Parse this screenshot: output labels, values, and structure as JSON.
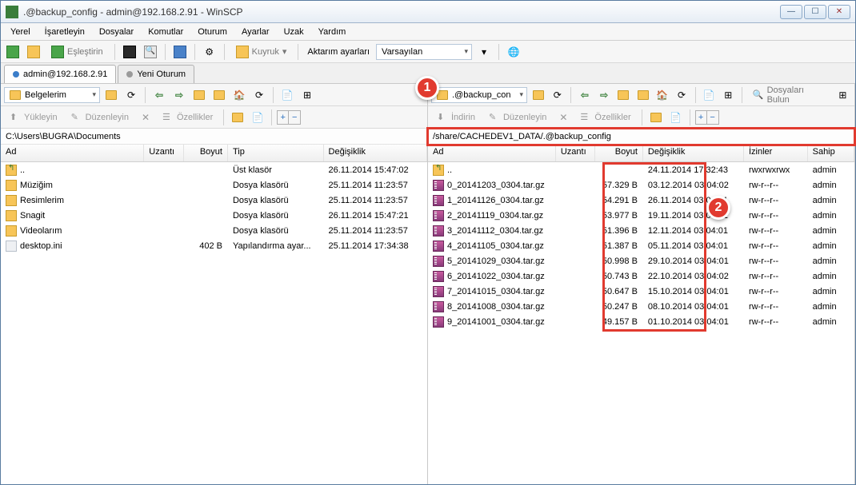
{
  "window": {
    "title": ".@backup_config - admin@192.168.2.91 - WinSCP"
  },
  "menu": {
    "m0": "Yerel",
    "m1": "İşaretleyin",
    "m2": "Dosyalar",
    "m3": "Komutlar",
    "m4": "Oturum",
    "m5": "Ayarlar",
    "m6": "Uzak",
    "m7": "Yardım"
  },
  "toolbar": {
    "sync": "Eşleştirin",
    "queue": "Kuyruk",
    "transfer_label": "Aktarım ayarları",
    "transfer_preset": "Varsayılan"
  },
  "tabs": {
    "t0": "admin@192.168.2.91",
    "t1": "Yeni Oturum"
  },
  "left": {
    "drive": "Belgelerim",
    "upload": "Yükleyin",
    "edit": "Düzenleyin",
    "props": "Özellikler",
    "path": "C:\\Users\\BUGRA\\Documents",
    "hdr": {
      "name": "Ad",
      "ext": "Uzantı",
      "size": "Boyut",
      "type": "Tip",
      "date": "Değişiklik"
    },
    "rows": [
      {
        "name": "..",
        "type": "Üst klasör",
        "date": "26.11.2014 15:47:02",
        "ico": "up"
      },
      {
        "name": "Müziğim",
        "type": "Dosya klasörü",
        "date": "25.11.2014 11:23:57",
        "ico": "folder"
      },
      {
        "name": "Resimlerim",
        "type": "Dosya klasörü",
        "date": "25.11.2014 11:23:57",
        "ico": "folder"
      },
      {
        "name": "Snagit",
        "type": "Dosya klasörü",
        "date": "26.11.2014 15:47:21",
        "ico": "folder"
      },
      {
        "name": "Videolarım",
        "type": "Dosya klasörü",
        "date": "25.11.2014 11:23:57",
        "ico": "folder"
      },
      {
        "name": "desktop.ini",
        "size": "402 B",
        "type": "Yapılandırma ayar...",
        "date": "25.11.2014 17:34:38",
        "ico": "file"
      }
    ]
  },
  "right": {
    "drive": ".@backup_con",
    "download": "İndirin",
    "edit": "Düzenleyin",
    "props": "Özellikler",
    "find": "Dosyaları Bulun",
    "path": "/share/CACHEDEV1_DATA/.@backup_config",
    "hdr": {
      "name": "Ad",
      "ext": "Uzantı",
      "size": "Boyut",
      "date": "Değişiklik",
      "perm": "İzinler",
      "own": "Sahip"
    },
    "rows": [
      {
        "name": "..",
        "date": "24.11.2014 17:32:43",
        "perm": "rwxrwxrwx",
        "own": "admin",
        "ico": "up"
      },
      {
        "name": "0_20141203_0304.tar.gz",
        "size": "57.329 B",
        "date": "03.12.2014 03:04:02",
        "perm": "rw-r--r--",
        "own": "admin",
        "ico": "archive"
      },
      {
        "name": "1_20141126_0304.tar.gz",
        "size": "54.291 B",
        "date": "26.11.2014 03:04:01",
        "perm": "rw-r--r--",
        "own": "admin",
        "ico": "archive"
      },
      {
        "name": "2_20141119_0304.tar.gz",
        "size": "53.977 B",
        "date": "19.11.2014 03:04:01",
        "perm": "rw-r--r--",
        "own": "admin",
        "ico": "archive"
      },
      {
        "name": "3_20141112_0304.tar.gz",
        "size": "51.396 B",
        "date": "12.11.2014 03:04:01",
        "perm": "rw-r--r--",
        "own": "admin",
        "ico": "archive"
      },
      {
        "name": "4_20141105_0304.tar.gz",
        "size": "51.387 B",
        "date": "05.11.2014 03:04:01",
        "perm": "rw-r--r--",
        "own": "admin",
        "ico": "archive"
      },
      {
        "name": "5_20141029_0304.tar.gz",
        "size": "50.998 B",
        "date": "29.10.2014 03:04:01",
        "perm": "rw-r--r--",
        "own": "admin",
        "ico": "archive"
      },
      {
        "name": "6_20141022_0304.tar.gz",
        "size": "50.743 B",
        "date": "22.10.2014 03:04:02",
        "perm": "rw-r--r--",
        "own": "admin",
        "ico": "archive"
      },
      {
        "name": "7_20141015_0304.tar.gz",
        "size": "50.647 B",
        "date": "15.10.2014 03:04:01",
        "perm": "rw-r--r--",
        "own": "admin",
        "ico": "archive"
      },
      {
        "name": "8_20141008_0304.tar.gz",
        "size": "50.247 B",
        "date": "08.10.2014 03:04:01",
        "perm": "rw-r--r--",
        "own": "admin",
        "ico": "archive"
      },
      {
        "name": "9_20141001_0304.tar.gz",
        "size": "49.157 B",
        "date": "01.10.2014 03:04:01",
        "perm": "rw-r--r--",
        "own": "admin",
        "ico": "archive"
      }
    ]
  },
  "callouts": {
    "c1": "1",
    "c2": "2"
  }
}
